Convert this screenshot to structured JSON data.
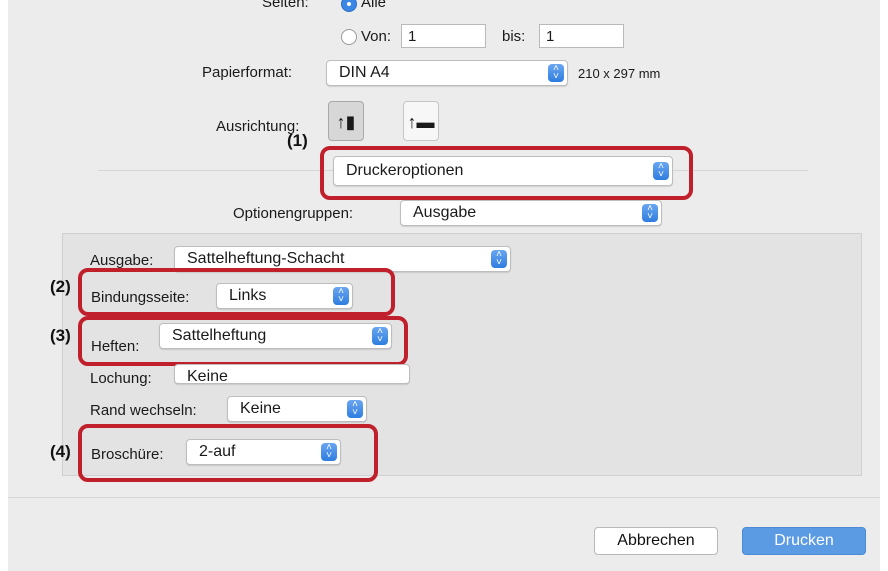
{
  "pages": {
    "label": "Seiten:",
    "all_label": "Alle",
    "from_label": "Von:",
    "from_value": "1",
    "to_label": "bis:",
    "to_value": "1"
  },
  "paper": {
    "label": "Papierformat:",
    "value": "DIN A4",
    "size_text": "210 x 297 mm"
  },
  "orientation": {
    "label": "Ausrichtung:",
    "portrait_icon": "portrait-orientation-icon",
    "landscape_icon": "landscape-orientation-icon"
  },
  "printer_options": {
    "value": "Druckeroptionen"
  },
  "option_groups": {
    "label": "Optionengruppen:",
    "value": "Ausgabe"
  },
  "panel": {
    "output_label": "Ausgabe:",
    "output_value": "Sattelheftung-Schacht",
    "binding_label": "Bindungsseite:",
    "binding_value": "Links",
    "staple_label": "Heften:",
    "staple_value": "Sattelheftung",
    "punch_label": "Lochung:",
    "punch_value": "Keine",
    "margin_label": "Rand wechseln:",
    "margin_value": "Keine",
    "booklet_label": "Broschüre:",
    "booklet_value": "2-auf"
  },
  "callouts": {
    "c1": "(1)",
    "c2": "(2)",
    "c3": "(3)",
    "c4": "(4)"
  },
  "buttons": {
    "cancel": "Abbrechen",
    "print": "Drucken"
  },
  "colors": {
    "highlight": "#c0202c",
    "accent": "#3b87e6",
    "print_button": "#5b9be4"
  }
}
